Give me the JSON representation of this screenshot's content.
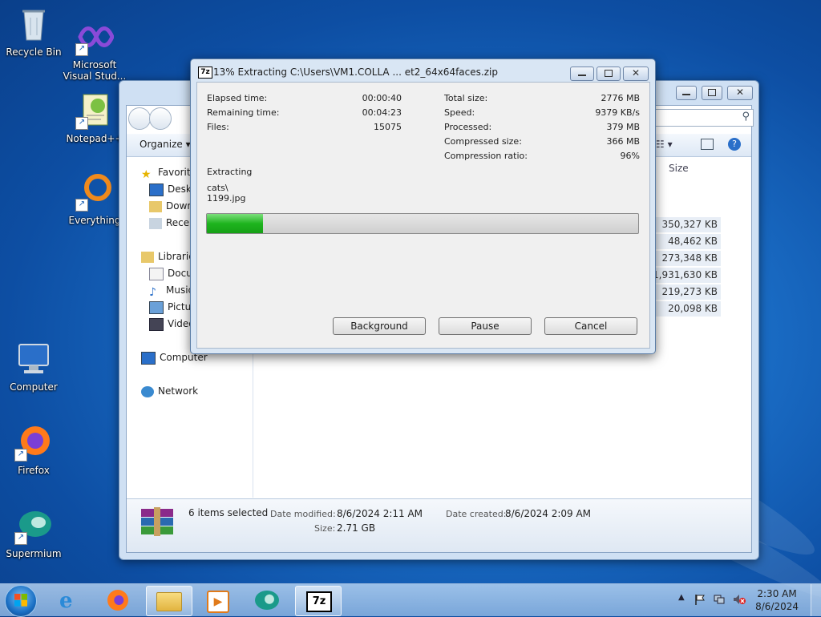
{
  "desktop": {
    "icons": [
      {
        "label": "Recycle Bin",
        "icon": "recycle-bin-icon"
      },
      {
        "label": "Microsoft Visual Stud...",
        "icon": "visual-studio-icon"
      },
      {
        "label": "Notepad++",
        "icon": "notepadpp-icon"
      },
      {
        "label": "Everything",
        "icon": "everything-icon"
      },
      {
        "label": "Computer",
        "icon": "computer-icon"
      },
      {
        "label": "Firefox",
        "icon": "firefox-icon"
      },
      {
        "label": "Supermium",
        "icon": "supermium-icon"
      }
    ]
  },
  "explorer": {
    "toolbar": {
      "organize": "Organize"
    },
    "nav": {
      "favorites": "Favorites",
      "desktop": "Desktop",
      "downloads": "Downloads",
      "recent": "Recent Places",
      "libraries": "Libraries",
      "documents": "Documents",
      "music": "Music",
      "pictures": "Pictures",
      "videos": "Videos",
      "computer": "Computer",
      "network": "Network"
    },
    "column_size": "Size",
    "sizes": [
      "350,327 KB",
      "48,462 KB",
      "273,348 KB",
      "1,931,630 KB",
      "219,273 KB",
      "20,098 KB"
    ],
    "status": {
      "selected": "6 items selected",
      "modified_label": "Date modified:",
      "modified_value": "8/6/2024 2:11 AM",
      "created_label": "Date created:",
      "created_value": "8/6/2024 2:09 AM",
      "size_label": "Size:",
      "size_value": "2.71 GB"
    }
  },
  "dialog": {
    "title": "13% Extracting C:\\Users\\VM1.COLLA ... et2_64x64faces.zip",
    "app_icon": "7z",
    "elapsed_label": "Elapsed time:",
    "elapsed_value": "00:00:40",
    "remaining_label": "Remaining time:",
    "remaining_value": "00:04:23",
    "files_label": "Files:",
    "files_value": "15075",
    "total_label": "Total size:",
    "total_value": "2776 MB",
    "speed_label": "Speed:",
    "speed_value": "9379 KB/s",
    "processed_label": "Processed:",
    "processed_value": "379 MB",
    "compressed_label": "Compressed size:",
    "compressed_value": "366 MB",
    "ratio_label": "Compression ratio:",
    "ratio_value": "96%",
    "status": "Extracting",
    "current_folder": "cats\\",
    "current_file": "1199.jpg",
    "progress_percent": 13,
    "buttons": {
      "background": "Background",
      "pause": "Pause",
      "cancel": "Cancel"
    }
  },
  "taskbar": {
    "time": "2:30 AM",
    "date": "8/6/2024",
    "items": [
      "start-orb",
      "internet-explorer",
      "firefox",
      "file-explorer",
      "media-player",
      "supermium",
      "7zip"
    ]
  },
  "colors": {
    "progress_fill": "#1eb41e",
    "desktop_bg": "#1b6fc8"
  }
}
